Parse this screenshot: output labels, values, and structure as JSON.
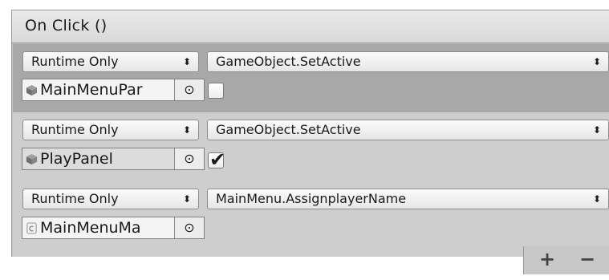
{
  "header": {
    "title": "On Click ()"
  },
  "entries": [
    {
      "runtime": "Runtime Only",
      "function": "GameObject.SetActive",
      "object": "MainMenuPar",
      "picker": "⊙",
      "checked": false
    },
    {
      "runtime": "Runtime Only",
      "function": "GameObject.SetActive",
      "object": "PlayPanel",
      "picker": "⊙",
      "checked": true,
      "check_glyph": "✔"
    },
    {
      "runtime": "Runtime Only",
      "function": "MainMenu.AssignplayerName",
      "object": "MainMenuMa",
      "picker": "⊙"
    }
  ],
  "dropdown_arrow": "⬍",
  "icons": {
    "gameobject": "cube-icon",
    "script": "script-icon",
    "picker": "object-picker-icon"
  },
  "footer": {
    "add_label": "+",
    "remove_label": "−"
  },
  "colors": {
    "selected_entry_bg": "#a8a8a8",
    "entry_bg": "#cecece",
    "header_bg": "#e2e2e2"
  }
}
